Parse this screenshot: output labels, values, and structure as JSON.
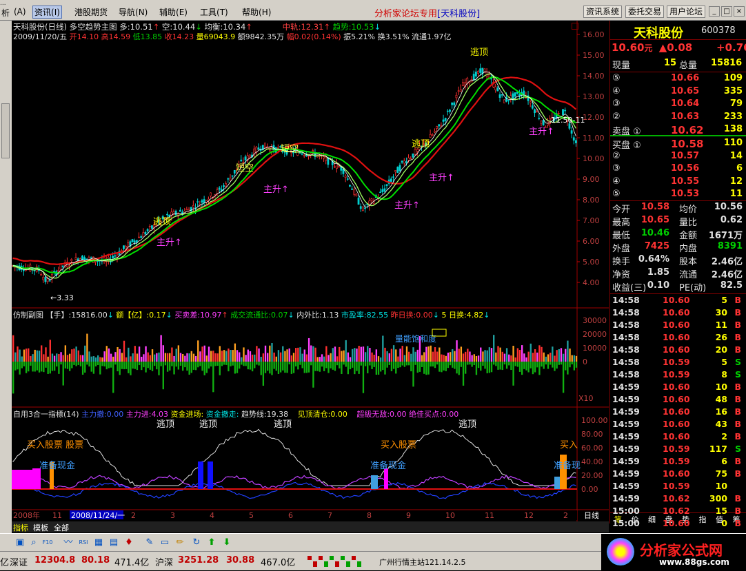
{
  "menu": {
    "items": [
      "资讯",
      "港股期货",
      "导航",
      "辅助",
      "工具",
      "帮助"
    ],
    "keys": [
      "(I)",
      "",
      "(N)",
      "(E)",
      "(T)",
      "(H)"
    ],
    "title_prefix": "分析家论坛专用",
    "title_stock": "[天科股份]",
    "buttons": [
      "资讯系统",
      "委托交易",
      "用户论坛"
    ],
    "left_stub": "析"
  },
  "main": {
    "title": "天科股份(日线)",
    "indicator": "多空趋势主图",
    "duo": "多:10.51",
    "kong": "空:10.44",
    "junheng": "均衡:10.34",
    "zhongzhou": "中轨:12.31",
    "qushi": "趋势:10.53",
    "bar_info": "2009/11/20/五",
    "open": "开14.10",
    "high": "高14.59",
    "low": "低13.85",
    "close": "收14.23",
    "vol": "量69043.9",
    "amt": "额9842.35万",
    "chg": "幅0.02(0.14%)",
    "amp": "振5.21%",
    "turn": "换3.51%",
    "float": "流通1.97亿",
    "y_axis": [
      "16.00",
      "15.00",
      "14.00",
      "13.00",
      "12.00",
      "11.00",
      "10.00",
      "9.00",
      "8.00",
      "7.00",
      "6.00",
      "5.00",
      "4.00"
    ],
    "low_mark": "←3.33",
    "tip": "11.50-11",
    "annots": [
      "逃顶",
      "洁空",
      "短空",
      "主升"
    ]
  },
  "vol_panel": {
    "name": "仿制副图",
    "hand": "【手】:15816.00",
    "e": "额【亿】:0.17",
    "maimai": "买卖差:10.97",
    "chengjiao": "成交流通比:0.07",
    "neiwai": "内外比:1.13",
    "pe": "市盈率:82.55",
    "zuori": "昨日换:0.00",
    "wuri": "5 日换:4.82",
    "y_axis": [
      "30000",
      "20000",
      "10000",
      "0"
    ],
    "scale": "X10",
    "sat_label": "量能饱和度"
  },
  "ind_panel": {
    "name": "自用3合一指標(14)",
    "zlc": "主力撤:0.00",
    "zlj": "主力进:4.03",
    "zjjc": "资金进场:",
    "zjcz": "资金撤走:",
    "qsx": "趋势线:19.38",
    "jjqc": "见顶清仓:0.00",
    "cjwd": "超級无敌:0.00",
    "jjmd": "绝佳买点:0.00",
    "y_axis": [
      "100.00",
      "80.00",
      "60.00",
      "40.00",
      "20.00",
      "0.00"
    ],
    "labels": [
      "逃顶",
      "逃顶",
      "逃顶",
      "逃顶",
      "买入股票 股票",
      "买入股票",
      "买入",
      "准备现金",
      "准备现金",
      "准备现"
    ]
  },
  "date_axis": {
    "labels": [
      "2008年",
      "11",
      "12",
      "2",
      "3",
      "4",
      "5",
      "6",
      "7",
      "8",
      "9",
      "10",
      "11",
      "12",
      "2"
    ],
    "cursor": "2008/11/24/一",
    "period": "日线"
  },
  "tabs": [
    "指标",
    "模板",
    "全部"
  ],
  "quote": {
    "name": "天科股份",
    "code": "600378",
    "price": "10.60",
    "unit": "元",
    "chg": "▲0.08",
    "pct": "+0.76",
    "xianliang_l": "现量",
    "xianliang": "15",
    "zongliang_l": "总量",
    "zongliang": "15816",
    "asks": [
      {
        "n": "⑤",
        "p": "10.66",
        "v": "109"
      },
      {
        "n": "④",
        "p": "10.65",
        "v": "335"
      },
      {
        "n": "③",
        "p": "10.64",
        "v": "79"
      },
      {
        "n": "②",
        "p": "10.63",
        "v": "233"
      },
      {
        "n": "卖盘 ①",
        "p": "10.62",
        "v": "138"
      }
    ],
    "bids": [
      {
        "n": "买盘 ①",
        "p": "10.58",
        "v": "110"
      },
      {
        "n": "②",
        "p": "10.57",
        "v": "14"
      },
      {
        "n": "③",
        "p": "10.56",
        "v": "6"
      },
      {
        "n": "④",
        "p": "10.55",
        "v": "12"
      },
      {
        "n": "⑤",
        "p": "10.53",
        "v": "11"
      }
    ],
    "stats": [
      [
        "今开",
        "10.58",
        "均价",
        "10.56"
      ],
      [
        "最高",
        "10.65",
        "量比",
        "0.62"
      ],
      [
        "最低",
        "10.46",
        "金额",
        "1671万"
      ],
      [
        "外盘",
        "7425",
        "内盘",
        "8391"
      ],
      [
        "换手",
        "0.64%",
        "股本",
        "2.46亿"
      ],
      [
        "净资",
        "1.85",
        "流通",
        "2.46亿"
      ],
      [
        "收益(三)",
        "0.10",
        "PE(动)",
        "82.5"
      ]
    ],
    "ticks": [
      [
        "14:58",
        "10.60",
        "5",
        "B"
      ],
      [
        "14:58",
        "10.60",
        "30",
        "B"
      ],
      [
        "14:58",
        "10.60",
        "11",
        "B"
      ],
      [
        "14:58",
        "10.60",
        "26",
        "B"
      ],
      [
        "14:58",
        "10.60",
        "20",
        "B"
      ],
      [
        "14:58",
        "10.59",
        "5",
        "S"
      ],
      [
        "14:58",
        "10.59",
        "8",
        "S"
      ],
      [
        "14:59",
        "10.60",
        "10",
        "B"
      ],
      [
        "14:59",
        "10.60",
        "48",
        "B"
      ],
      [
        "14:59",
        "10.60",
        "16",
        "B"
      ],
      [
        "14:59",
        "10.60",
        "43",
        "B"
      ],
      [
        "14:59",
        "10.60",
        "2",
        "B"
      ],
      [
        "14:59",
        "10.59",
        "117",
        "S"
      ],
      [
        "14:59",
        "10.59",
        "6",
        "B"
      ],
      [
        "14:59",
        "10.60",
        "75",
        "B"
      ],
      [
        "14:59",
        "10.59",
        "10",
        ""
      ],
      [
        "14:59",
        "10.62",
        "300",
        "B"
      ],
      [
        "15:00",
        "10.62",
        "15",
        "B"
      ],
      [
        "15:00",
        "10.60",
        "0",
        "B"
      ]
    ],
    "bottom_tabs": [
      "笔",
      "价",
      "细",
      "盘",
      "势",
      "指",
      "值",
      "筹"
    ]
  },
  "status": {
    "sz_l": "深证",
    "sz": "12304.8",
    "sz_c": "80.18",
    "sz_a": "471.4亿",
    "hs_l": "沪深",
    "hs": "3251.28",
    "hs_c": "30.88",
    "hs_a": "467.0亿",
    "server": "广州行情主站121.14.2.5",
    "logo": "分析家公式网",
    "logo_url": "www.88gs.com",
    "left_stub": "亿"
  },
  "colors": {
    "up": "#ff3333",
    "down": "#00cc00",
    "ma_red": "#e01010",
    "ma_green": "#00e000",
    "ma_lg": "#a0ff60",
    "ma_white": "#ffffff",
    "ma_yellow": "#ffff40"
  }
}
